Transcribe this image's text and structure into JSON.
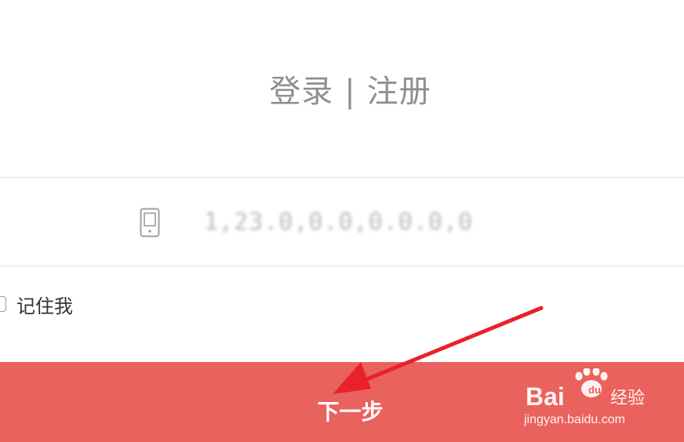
{
  "header": {
    "login_tab": "登录",
    "separator": "|",
    "register_tab": "注册"
  },
  "form": {
    "phone_icon": "mobile-phone-icon",
    "phone_value": "1,23.0,0.0,0.0.0,0"
  },
  "remember": {
    "label": "记住我",
    "checked": false
  },
  "actions": {
    "next_label": "下一步"
  },
  "annotation": {
    "arrow_color": "#e8212b"
  },
  "watermark": {
    "brand_lettering": "Baidu经验",
    "url": "jingyan.baidu.com"
  },
  "colors": {
    "primary_button": "#ea625d",
    "title_text": "#8f8f8f"
  }
}
